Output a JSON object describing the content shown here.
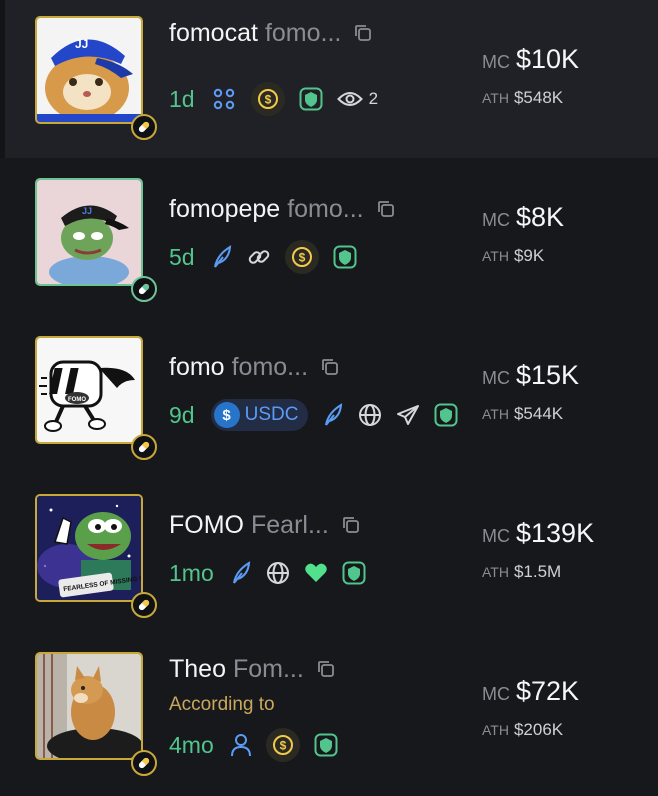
{
  "tokens": [
    {
      "ticker": "fomocat",
      "symbol": "fomo...",
      "age": "1d",
      "holders": "2",
      "mc_label": "MC",
      "mc": "$10K",
      "ath_label": "ATH",
      "ath": "$548K",
      "avatar": "cat-with-blue-cap",
      "frame_color": "#c9a83a"
    },
    {
      "ticker": "fomopepe",
      "symbol": "fomo...",
      "age": "5d",
      "mc_label": "MC",
      "mc": "$8K",
      "ath_label": "ATH",
      "ath": "$9K",
      "avatar": "pepe-with-cap",
      "frame_color": "#6cc495"
    },
    {
      "ticker": "fomo",
      "symbol": "fomo...",
      "age": "9d",
      "quote": "USDC",
      "mc_label": "MC",
      "mc": "$15K",
      "ath_label": "ATH",
      "ath": "$544K",
      "avatar": "fomo-runner-mascot",
      "frame_color": "#c9a83a"
    },
    {
      "ticker": "FOMO",
      "symbol": "Fearl...",
      "age": "1mo",
      "mc_label": "MC",
      "mc": "$139K",
      "ath_label": "ATH",
      "ath": "$1.5M",
      "avatar": "pepe-fearless-of-missing-out",
      "frame_color": "#c9a83a"
    },
    {
      "ticker": "Theo",
      "symbol": "Fom...",
      "description": "According to",
      "age": "4mo",
      "mc_label": "MC",
      "mc": "$72K",
      "ath_label": "ATH",
      "ath": "$206K",
      "avatar": "shiba-dog-photo",
      "frame_color": "#c9a83a"
    }
  ],
  "avatar_texts": {
    "fomo_logo": "FOMO",
    "fearless_caption": "FEARLESS OF MISSING OUT"
  },
  "icons": {
    "copy": "copy-icon",
    "pill": "pill-icon",
    "community": "community-icon",
    "dev": "person-icon",
    "coin": "coin-dollar-icon",
    "shield": "shield-lion-icon",
    "eye": "eye-icon",
    "twitter": "feather-icon",
    "link": "link-icon",
    "website": "globe-icon",
    "telegram": "telegram-icon",
    "heart": "heart-icon"
  },
  "colors": {
    "accent_green": "#52c58c",
    "gold": "#c9a83a",
    "muted": "#8a8c94",
    "blue": "#5b9cf5"
  }
}
